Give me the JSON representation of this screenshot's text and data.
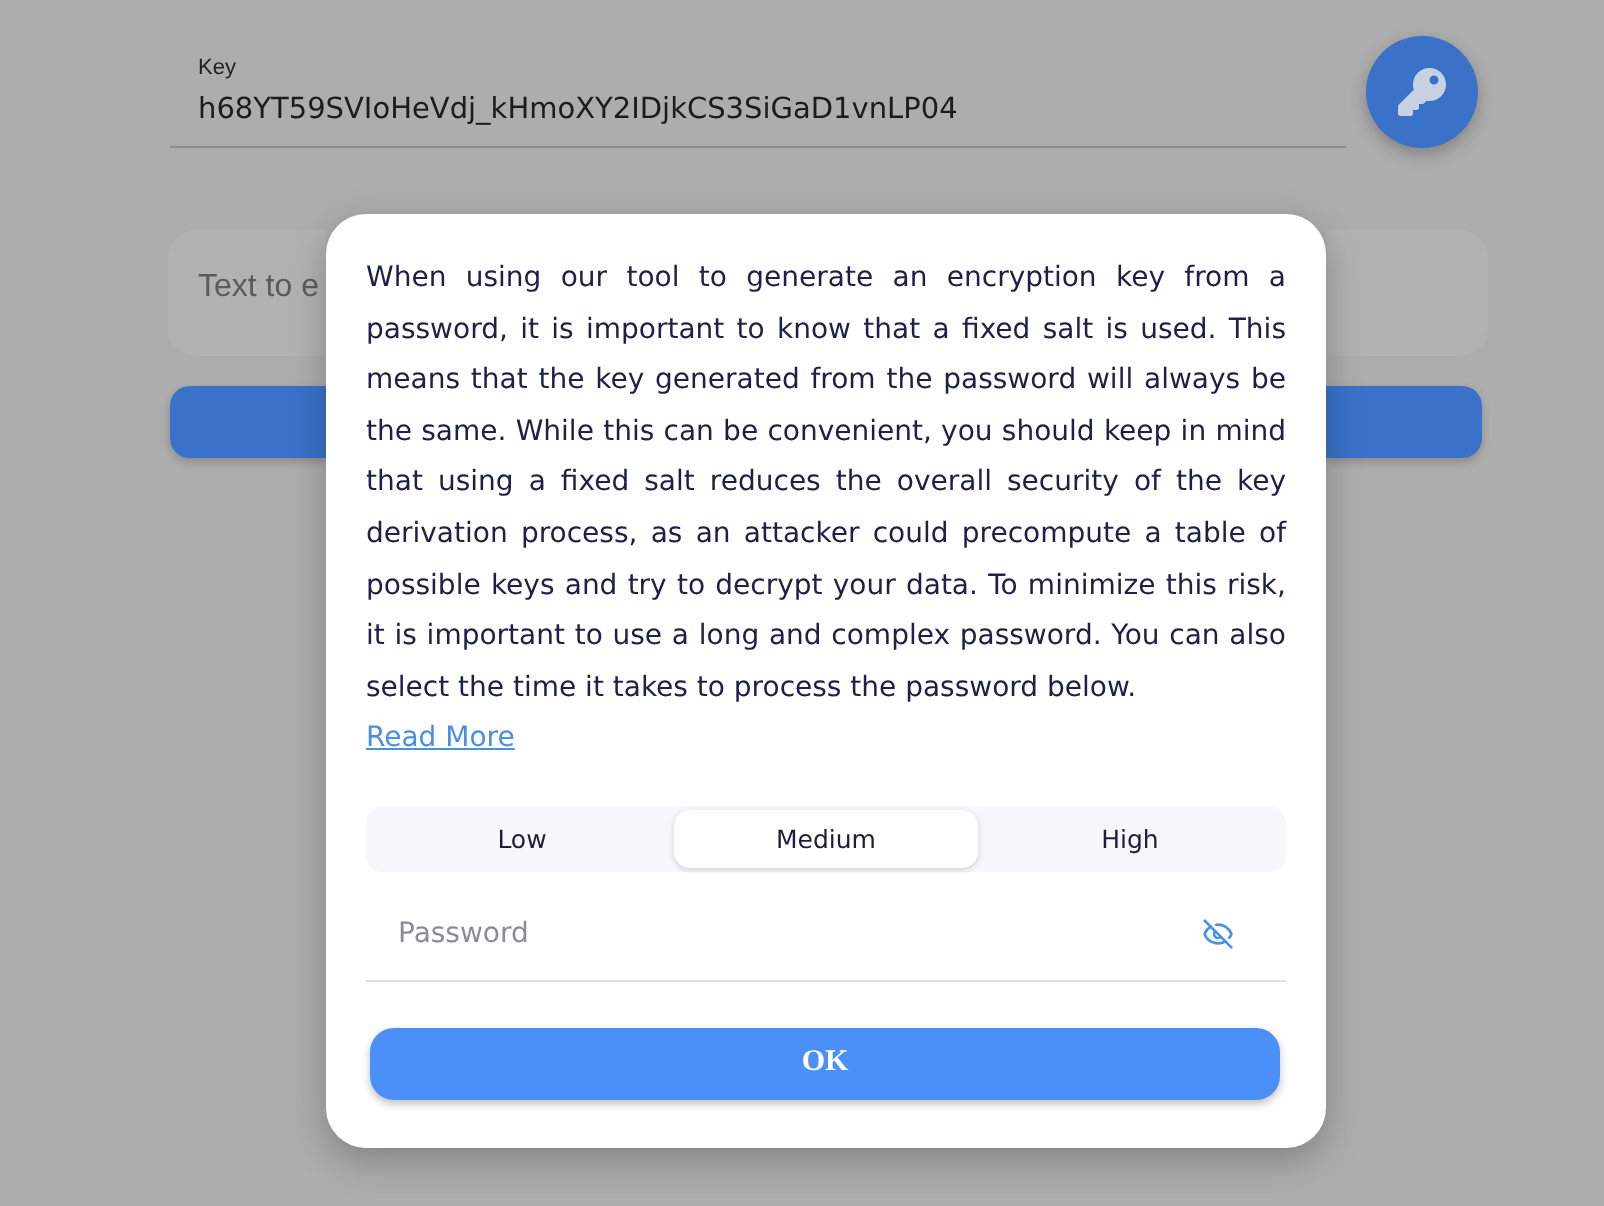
{
  "background_page": {
    "key_field": {
      "label": "Key",
      "value": "h68YT59SVIoHeVdj_kHmoXY2IDjkCS3SiGaD1vnLP04"
    },
    "text_input": {
      "placeholder": "Text to e"
    }
  },
  "dialog": {
    "message": "When using our tool to generate an encryption key from a password, it is important to know that a fixed salt is used. This means that the key generated from the password will always be the same. While this can be convenient, you should keep in mind that using a fixed salt reduces the overall security of the key derivation process, as an attacker could precompute a table of possible keys and try to decrypt your data. To minimize this risk, it is important to use a long and complex password. You can also select the time it takes to process the password below.",
    "link": "Read More",
    "time_options": [
      {
        "label": "Low",
        "selected": false
      },
      {
        "label": "Medium",
        "selected": true
      },
      {
        "label": "High",
        "selected": false
      }
    ],
    "password_field": {
      "placeholder": "Password"
    },
    "buttons": [
      "OK"
    ]
  }
}
